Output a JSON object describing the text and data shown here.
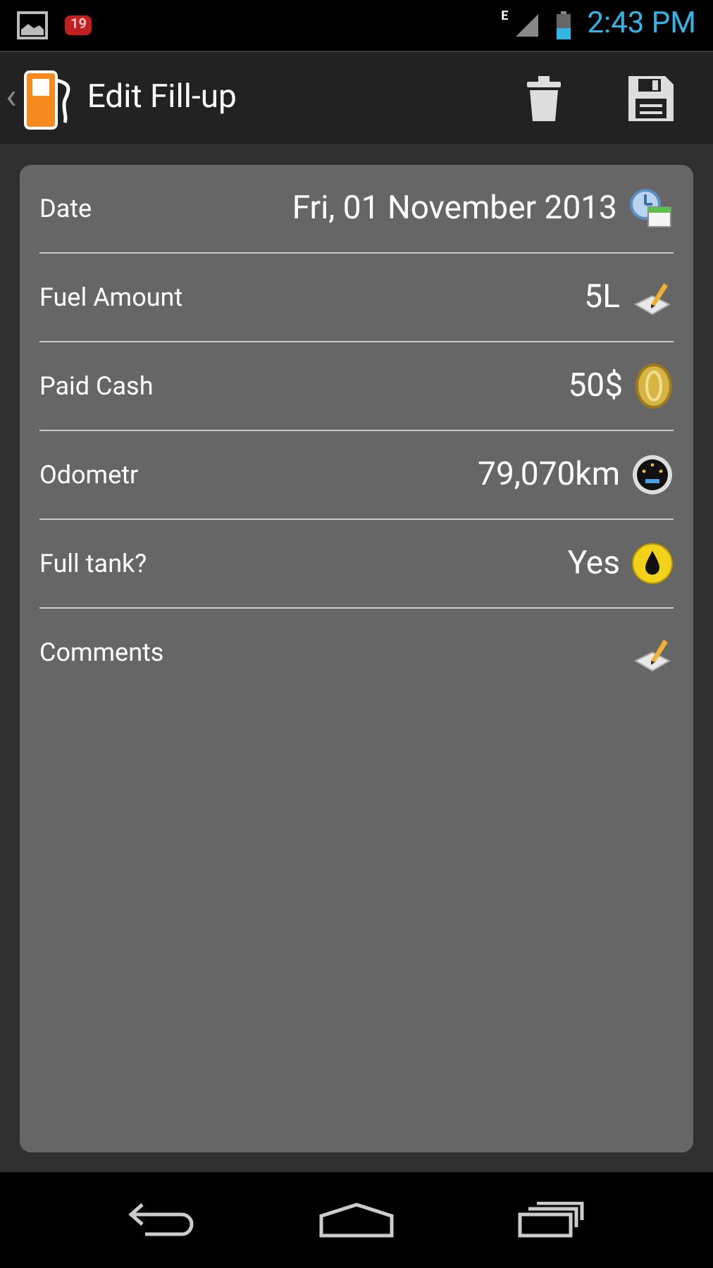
{
  "status_bar": {
    "notification_count": "19",
    "network": "E",
    "time": "2:43 PM"
  },
  "action_bar": {
    "back": "‹",
    "title": "Edit Fill-up"
  },
  "fields": [
    {
      "kind": "date",
      "label": "Date",
      "value": "Fri, 01 November 2013"
    },
    {
      "kind": "amount",
      "label": "Fuel Amount",
      "value": "5L"
    },
    {
      "kind": "cash",
      "label": "Paid Cash",
      "value": "50$"
    },
    {
      "kind": "odometer",
      "label": "Odometr",
      "value": "79,070km"
    },
    {
      "kind": "toggle",
      "label": "Full tank?",
      "value": "Yes"
    },
    {
      "kind": "comments",
      "label": "Comments"
    }
  ]
}
